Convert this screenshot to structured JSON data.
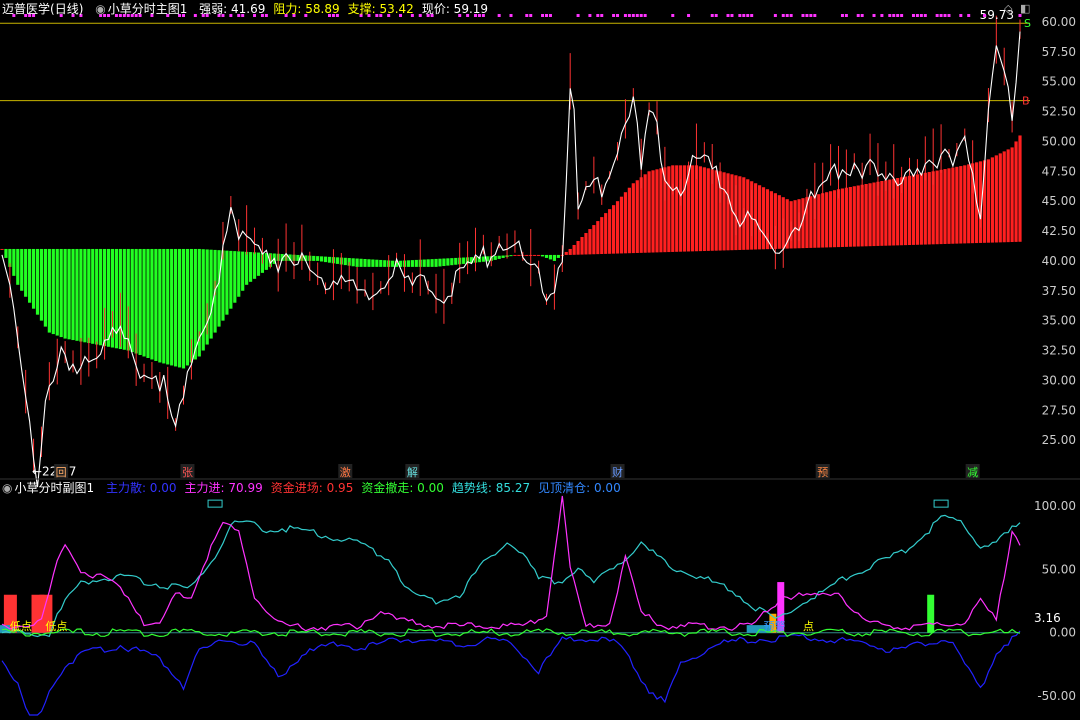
{
  "main_header": {
    "stock_name": "迈普医学",
    "period": "(日线)",
    "indicator_name": "小草分时主图1",
    "items": [
      {
        "label": "强弱: 41.69",
        "color": "#ffffff"
      },
      {
        "label": "阻力: 58.89",
        "color": "#ffff00"
      },
      {
        "label": "支撑: 53.42",
        "color": "#ffff00"
      },
      {
        "label": "现价: 59.19",
        "color": "#ffffff"
      }
    ]
  },
  "sub_header": {
    "indicator_name": "小草分时副图1",
    "items": [
      {
        "label": "主力散: 0.00",
        "color": "#3333ff"
      },
      {
        "label": "主力进: 70.99",
        "color": "#ff33ff"
      },
      {
        "label": "资金进场: 0.95",
        "color": "#ff3333"
      },
      {
        "label": "资金撤走: 0.00",
        "color": "#33ff33"
      },
      {
        "label": "趋势线: 85.27",
        "color": "#33dddd"
      },
      {
        "label": "见顶清仓: 0.00",
        "color": "#3388ff"
      }
    ]
  },
  "controls": {
    "diamond": "◇",
    "window": "◧"
  },
  "colors": {
    "price_line": "#ffffff",
    "candle_up": "#ff3333",
    "band_up": "#ff2020",
    "band_down": "#22ff22",
    "level_line": "#c8b400",
    "axis_text": "#cccccc",
    "magenta": "#ff33ff",
    "cyan": "#33cccc",
    "blue": "#2222ff",
    "green": "#33ff33",
    "orange": "#ffaa00"
  },
  "chart_data": [
    {
      "type": "line",
      "title": "小草分时主图1",
      "y_ticks": [
        "60.00",
        "57.50",
        "55.00",
        "52.50",
        "50.00",
        "47.50",
        "45.00",
        "42.50",
        "40.00",
        "37.50",
        "35.00",
        "32.50",
        "30.00",
        "27.50",
        "25.00"
      ],
      "ylim": [
        22.5,
        61
      ],
      "resistance": 58.89,
      "support": 53.42,
      "current_price": 59.19,
      "resistance_label": "59.73",
      "low_label": "22.37",
      "signal_tags": [
        {
          "text": "回",
          "x_index": 15
        },
        {
          "text": "张",
          "x_index": 47
        },
        {
          "text": "激",
          "x_index": 87
        },
        {
          "text": "解",
          "x_index": 104
        },
        {
          "text": "财",
          "x_index": 156
        },
        {
          "text": "预",
          "x_index": 208
        },
        {
          "text": "减",
          "x_index": 246
        }
      ],
      "buy_label": "B",
      "sell_label": "S",
      "close_keypoints": [
        [
          0,
          40.5
        ],
        [
          2,
          38
        ],
        [
          4,
          34
        ],
        [
          6,
          30
        ],
        [
          8,
          25
        ],
        [
          9,
          22.4
        ],
        [
          11,
          28
        ],
        [
          13,
          30
        ],
        [
          15,
          33
        ],
        [
          17,
          31
        ],
        [
          19,
          32
        ],
        [
          21,
          33
        ],
        [
          25,
          33.5
        ],
        [
          30,
          34
        ],
        [
          34,
          32
        ],
        [
          38,
          31.5
        ],
        [
          41,
          30
        ],
        [
          44,
          26
        ],
        [
          46,
          29
        ],
        [
          48,
          33
        ],
        [
          52,
          36
        ],
        [
          56,
          41
        ],
        [
          58,
          44
        ],
        [
          60,
          42
        ],
        [
          64,
          43
        ],
        [
          68,
          41
        ],
        [
          72,
          40
        ],
        [
          76,
          40
        ],
        [
          80,
          39.5
        ],
        [
          84,
          39
        ],
        [
          88,
          38
        ],
        [
          92,
          37
        ],
        [
          96,
          39
        ],
        [
          100,
          39.5
        ],
        [
          104,
          38
        ],
        [
          108,
          38.5
        ],
        [
          112,
          38
        ],
        [
          116,
          39
        ],
        [
          120,
          40
        ],
        [
          124,
          41.5
        ],
        [
          128,
          42.5
        ],
        [
          131,
          41
        ],
        [
          134,
          40
        ],
        [
          137,
          38
        ],
        [
          140,
          39
        ],
        [
          142,
          41
        ],
        [
          144,
          55
        ],
        [
          145,
          52
        ],
        [
          146,
          44
        ],
        [
          148,
          46
        ],
        [
          152,
          47
        ],
        [
          156,
          50
        ],
        [
          158,
          53
        ],
        [
          160,
          54
        ],
        [
          162,
          48
        ],
        [
          164,
          53
        ],
        [
          166,
          52
        ],
        [
          168,
          48
        ],
        [
          172,
          47
        ],
        [
          176,
          49
        ],
        [
          180,
          48
        ],
        [
          184,
          46
        ],
        [
          188,
          44
        ],
        [
          192,
          43
        ],
        [
          196,
          41
        ],
        [
          200,
          43
        ],
        [
          204,
          45
        ],
        [
          208,
          46
        ],
        [
          212,
          48
        ],
        [
          216,
          49
        ],
        [
          220,
          48
        ],
        [
          224,
          47
        ],
        [
          228,
          48
        ],
        [
          232,
          49
        ],
        [
          236,
          48
        ],
        [
          240,
          49
        ],
        [
          244,
          51
        ],
        [
          246,
          48
        ],
        [
          248,
          44
        ],
        [
          250,
          52
        ],
        [
          252,
          58
        ],
        [
          254,
          56
        ],
        [
          256,
          53
        ],
        [
          258,
          59.19
        ]
      ],
      "band_keypoints": [
        [
          0,
          41
        ],
        [
          4,
          38
        ],
        [
          8,
          36
        ],
        [
          12,
          34
        ],
        [
          16,
          33.5
        ],
        [
          24,
          33
        ],
        [
          32,
          32.5
        ],
        [
          40,
          31.5
        ],
        [
          46,
          31
        ],
        [
          50,
          32
        ],
        [
          56,
          35
        ],
        [
          62,
          38
        ],
        [
          70,
          40
        ],
        [
          80,
          40
        ],
        [
          90,
          39.5
        ],
        [
          100,
          39.5
        ],
        [
          110,
          39.5
        ],
        [
          124,
          40
        ],
        [
          130,
          40.5
        ],
        [
          136,
          40.5
        ],
        [
          140,
          40
        ],
        [
          144,
          41
        ],
        [
          150,
          43
        ],
        [
          156,
          45
        ],
        [
          160,
          46.5
        ],
        [
          164,
          47.5
        ],
        [
          170,
          48
        ],
        [
          176,
          48
        ],
        [
          182,
          47.5
        ],
        [
          188,
          47
        ],
        [
          194,
          46
        ],
        [
          200,
          45
        ],
        [
          206,
          45.5
        ],
        [
          212,
          46
        ],
        [
          220,
          46.5
        ],
        [
          228,
          47
        ],
        [
          236,
          47.5
        ],
        [
          244,
          48
        ],
        [
          250,
          48.5
        ],
        [
          256,
          49.5
        ],
        [
          258,
          50.5
        ]
      ],
      "band_base_keypoints": [
        [
          0,
          41
        ],
        [
          50,
          41
        ],
        [
          100,
          40
        ],
        [
          130,
          40.5
        ],
        [
          144,
          40.5
        ],
        [
          258,
          41.6
        ]
      ]
    },
    {
      "type": "line",
      "title": "小草分时副图1",
      "y_ticks": [
        "100.00",
        "50.00",
        "0.00",
        "-50.00"
      ],
      "ylim": [
        -65,
        108
      ],
      "last_value_label": "3.16",
      "text_marks": [
        {
          "text": "低点",
          "x_index": 2
        },
        {
          "text": "低点",
          "x_index": 11
        },
        {
          "text": "预警",
          "x_index": 193
        },
        {
          "text": "点",
          "x_index": 203
        }
      ],
      "box_marks": [
        54,
        238
      ],
      "series": [
        {
          "name": "趋势线",
          "color_key": "cyan",
          "keypoints": [
            [
              0,
              0
            ],
            [
              12,
              0
            ],
            [
              16,
              25
            ],
            [
              20,
              40
            ],
            [
              30,
              45
            ],
            [
              40,
              38
            ],
            [
              48,
              35
            ],
            [
              54,
              60
            ],
            [
              58,
              85
            ],
            [
              62,
              88
            ],
            [
              66,
              82
            ],
            [
              72,
              82
            ],
            [
              80,
              78
            ],
            [
              90,
              72
            ],
            [
              98,
              58
            ],
            [
              104,
              30
            ],
            [
              110,
              25
            ],
            [
              116,
              30
            ],
            [
              122,
              55
            ],
            [
              128,
              72
            ],
            [
              132,
              62
            ],
            [
              136,
              42
            ],
            [
              142,
              40
            ],
            [
              146,
              52
            ],
            [
              150,
              38
            ],
            [
              156,
              55
            ],
            [
              162,
              70
            ],
            [
              168,
              55
            ],
            [
              176,
              45
            ],
            [
              184,
              35
            ],
            [
              192,
              18
            ],
            [
              196,
              10
            ],
            [
              204,
              25
            ],
            [
              212,
              40
            ],
            [
              220,
              52
            ],
            [
              228,
              63
            ],
            [
              234,
              78
            ],
            [
              238,
              92
            ],
            [
              244,
              85
            ],
            [
              248,
              68
            ],
            [
              252,
              70
            ],
            [
              256,
              82
            ],
            [
              258,
              85
            ]
          ]
        },
        {
          "name": "主力进",
          "color_key": "magenta",
          "keypoints": [
            [
              0,
              5
            ],
            [
              10,
              8
            ],
            [
              14,
              55
            ],
            [
              16,
              70
            ],
            [
              20,
              50
            ],
            [
              28,
              40
            ],
            [
              32,
              30
            ],
            [
              36,
              8
            ],
            [
              40,
              5
            ],
            [
              44,
              30
            ],
            [
              48,
              28
            ],
            [
              52,
              60
            ],
            [
              56,
              85
            ],
            [
              60,
              80
            ],
            [
              64,
              30
            ],
            [
              68,
              12
            ],
            [
              72,
              5
            ],
            [
              80,
              4
            ],
            [
              90,
              5
            ],
            [
              96,
              18
            ],
            [
              100,
              10
            ],
            [
              108,
              6
            ],
            [
              116,
              5
            ],
            [
              124,
              6
            ],
            [
              132,
              5
            ],
            [
              138,
              15
            ],
            [
              142,
              108
            ],
            [
              144,
              50
            ],
            [
              148,
              5
            ],
            [
              154,
              8
            ],
            [
              158,
              60
            ],
            [
              162,
              15
            ],
            [
              168,
              5
            ],
            [
              180,
              5
            ],
            [
              190,
              5
            ],
            [
              198,
              30
            ],
            [
              204,
              28
            ],
            [
              212,
              32
            ],
            [
              216,
              15
            ],
            [
              220,
              8
            ],
            [
              228,
              5
            ],
            [
              236,
              5
            ],
            [
              244,
              8
            ],
            [
              248,
              25
            ],
            [
              252,
              10
            ],
            [
              256,
              80
            ],
            [
              258,
              70.99
            ]
          ]
        },
        {
          "name": "主力散",
          "color_key": "blue",
          "keypoints": [
            [
              0,
              -20
            ],
            [
              4,
              -40
            ],
            [
              8,
              -80
            ],
            [
              12,
              -45
            ],
            [
              16,
              -25
            ],
            [
              22,
              -15
            ],
            [
              30,
              -10
            ],
            [
              40,
              -20
            ],
            [
              46,
              -42
            ],
            [
              50,
              -15
            ],
            [
              56,
              -5
            ],
            [
              64,
              -10
            ],
            [
              70,
              -35
            ],
            [
              76,
              -18
            ],
            [
              84,
              -8
            ],
            [
              92,
              -12
            ],
            [
              100,
              -5
            ],
            [
              108,
              -6
            ],
            [
              116,
              -10
            ],
            [
              124,
              -5
            ],
            [
              130,
              -10
            ],
            [
              136,
              -30
            ],
            [
              142,
              -6
            ],
            [
              148,
              -5
            ],
            [
              156,
              -8
            ],
            [
              164,
              -45
            ],
            [
              168,
              -55
            ],
            [
              172,
              -25
            ],
            [
              180,
              -10
            ],
            [
              190,
              -5
            ],
            [
              200,
              -4
            ],
            [
              210,
              -5
            ],
            [
              220,
              -8
            ],
            [
              226,
              -15
            ],
            [
              232,
              -10
            ],
            [
              240,
              -5
            ],
            [
              248,
              -45
            ],
            [
              252,
              -15
            ],
            [
              256,
              -5
            ],
            [
              258,
              0
            ]
          ]
        },
        {
          "name": "资金进场",
          "color_key": "green",
          "keypoints": [
            [
              0,
              0
            ],
            [
              40,
              0
            ],
            [
              80,
              0
            ],
            [
              120,
              0
            ],
            [
              160,
              0
            ],
            [
              200,
              0
            ],
            [
              240,
              0
            ],
            [
              258,
              0
            ]
          ]
        }
      ],
      "bars": [
        {
          "x_index": 2,
          "value": 30,
          "color_key": "candle_up"
        },
        {
          "x_index": 9,
          "value": 30,
          "color_key": "candle_up"
        },
        {
          "x_index": 11,
          "value": 30,
          "color_key": "candle_up"
        },
        {
          "x_index": 198,
          "value": 40,
          "color_key": "magenta"
        },
        {
          "x_index": 196,
          "value": 15,
          "color_key": "orange"
        },
        {
          "x_index": 236,
          "value": 30,
          "color_key": "green"
        }
      ]
    }
  ]
}
